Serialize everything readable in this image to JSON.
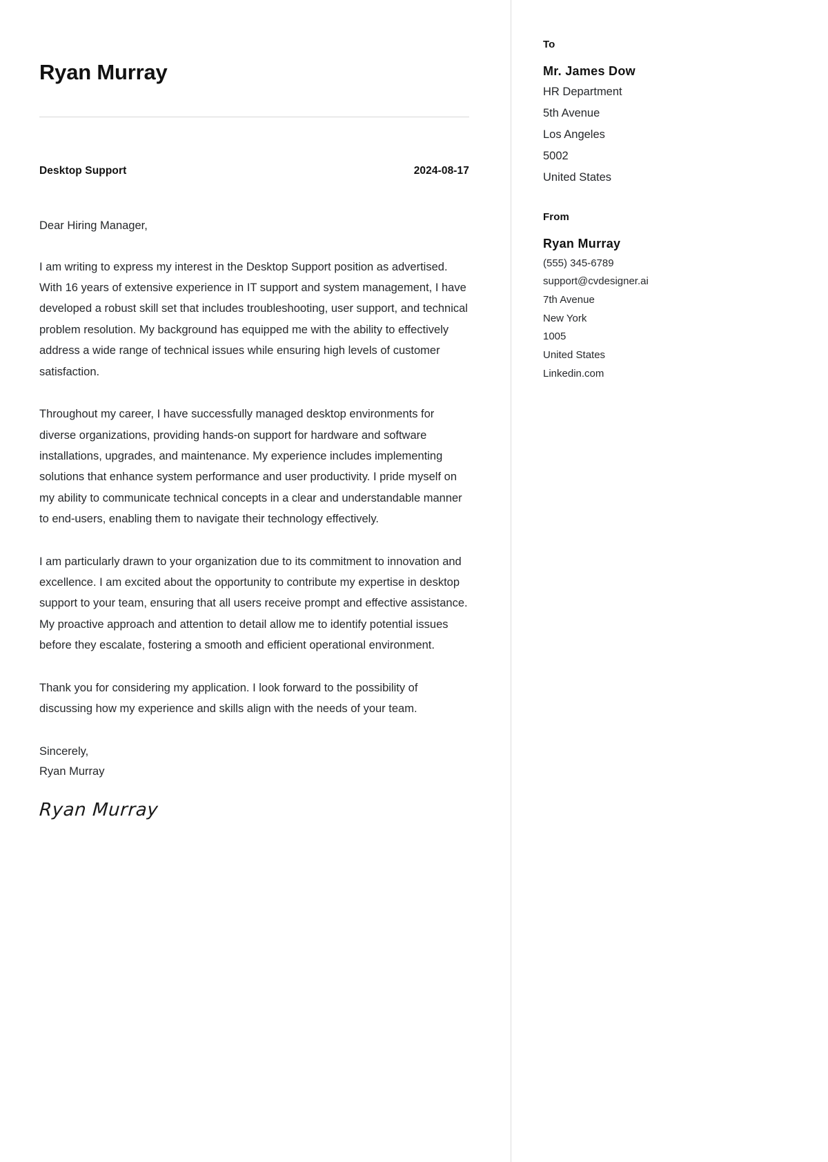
{
  "letter": {
    "name": "Ryan Murray",
    "job_title": "Desktop Support",
    "date": "2024-08-17",
    "salutation": "Dear Hiring Manager,",
    "paragraphs": [
      "I am writing to express my interest in the Desktop Support position as advertised. With 16 years of extensive experience in IT support and system management, I have developed a robust skill set that includes troubleshooting, user support, and technical problem resolution. My background has equipped me with the ability to effectively address a wide range of technical issues while ensuring high levels of customer satisfaction.",
      "Throughout my career, I have successfully managed desktop environments for diverse organizations, providing hands-on support for hardware and software installations, upgrades, and maintenance. My experience includes implementing solutions that enhance system performance and user productivity. I pride myself on my ability to communicate technical concepts in a clear and understandable manner to end-users, enabling them to navigate their technology effectively.",
      "I am particularly drawn to your organization due to its commitment to innovation and excellence. I am excited about the opportunity to contribute my expertise in desktop support to your team, ensuring that all users receive prompt and effective assistance. My proactive approach and attention to detail allow me to identify potential issues before they escalate, fostering a smooth and efficient operational environment.",
      "Thank you for considering my application. I look forward to the possibility of discussing how my experience and skills align with the needs of your team."
    ],
    "closing_salutation": "Sincerely,",
    "closing_name": "Ryan Murray",
    "signature": "Ryan Murray"
  },
  "sidebar": {
    "to": {
      "heading": "To",
      "recipient": "Mr. James Dow",
      "lines": [
        "HR Department",
        "5th Avenue",
        "Los Angeles",
        "5002",
        "United States"
      ]
    },
    "from": {
      "heading": "From",
      "sender": "Ryan Murray",
      "lines": [
        "(555) 345-6789",
        "support@cvdesigner.ai",
        "7th Avenue",
        "New York",
        "1005",
        "United States",
        "Linkedin.com"
      ]
    }
  },
  "colors": {
    "text": "#26282b",
    "heading": "#111111",
    "rule": "#d8d8d8",
    "divider": "#dcdcdc",
    "background": "#ffffff"
  }
}
